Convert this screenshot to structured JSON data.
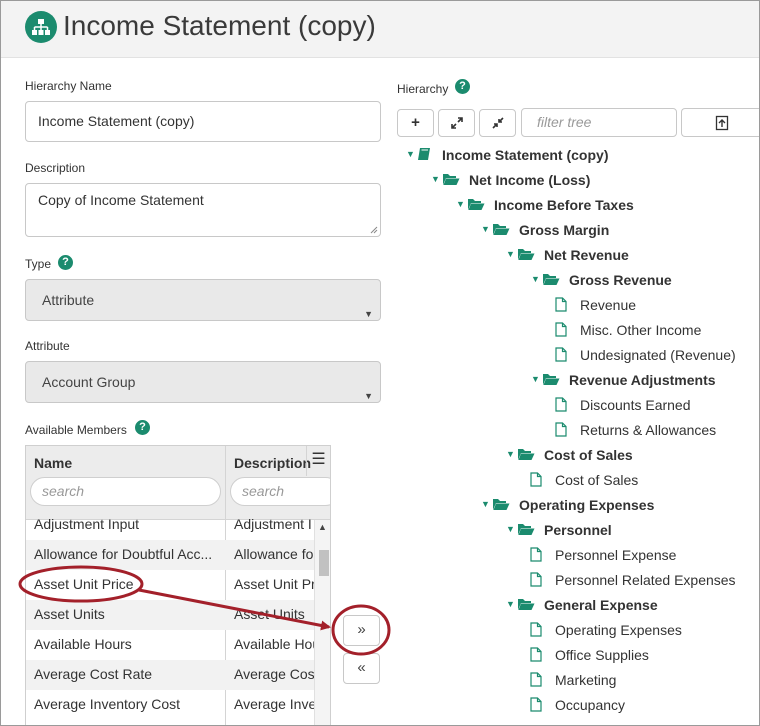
{
  "header": {
    "title": "Income Statement (copy)",
    "icon": "hierarchy-icon"
  },
  "form": {
    "hierarchy_name_label": "Hierarchy Name",
    "hierarchy_name_value": "Income Statement (copy)",
    "description_label": "Description",
    "description_value": "Copy of Income Statement",
    "type_label": "Type",
    "type_value": "Attribute",
    "attribute_label": "Attribute",
    "attribute_value": "Account Group",
    "available_members_label": "Available Members",
    "help_glyph": "?"
  },
  "grid": {
    "col_name": "Name",
    "col_description": "Description",
    "search_placeholder": "search",
    "rows": [
      {
        "name": "Adjustment Input",
        "description": "Adjustment I"
      },
      {
        "name": "Allowance for Doubtful Acc...",
        "description": "Allowance fo"
      },
      {
        "name": "Asset Unit Price",
        "description": "Asset Unit Pr"
      },
      {
        "name": "Asset Units",
        "description": "Asset Units"
      },
      {
        "name": "Available Hours",
        "description": "Available Hou"
      },
      {
        "name": "Average Cost Rate",
        "description": "Average Cost"
      },
      {
        "name": "Average Inventory Cost",
        "description": "Average Inve"
      }
    ]
  },
  "move": {
    "add": "»",
    "remove": "«"
  },
  "hierarchy": {
    "label": "Hierarchy",
    "filter_placeholder": "filter tree",
    "toolbar": {
      "add": "+",
      "expand": "⤢",
      "collapse": "⤡",
      "export": "⇡"
    },
    "tree": {
      "root": "Income Statement (copy)",
      "net_income": "Net Income (Loss)",
      "income_before_taxes": "Income Before Taxes",
      "gross_margin": "Gross Margin",
      "net_revenue": "Net Revenue",
      "gross_revenue": "Gross Revenue",
      "revenue": "Revenue",
      "misc_other_income": "Misc. Other Income",
      "undesignated_revenue": "Undesignated (Revenue)",
      "revenue_adjustments": "Revenue Adjustments",
      "discounts_earned": "Discounts Earned",
      "returns_allowances": "Returns & Allowances",
      "cost_of_sales_group": "Cost of Sales",
      "cost_of_sales": "Cost of Sales",
      "operating_expenses_group": "Operating Expenses",
      "personnel": "Personnel",
      "personnel_expense": "Personnel Expense",
      "personnel_related": "Personnel Related Expenses",
      "general_expense": "General Expense",
      "operating_expenses": "Operating Expenses",
      "office_supplies": "Office Supplies",
      "marketing": "Marketing",
      "occupancy": "Occupancy"
    }
  },
  "colors": {
    "accent": "#1b8b6e",
    "annotation": "#a3202a"
  }
}
